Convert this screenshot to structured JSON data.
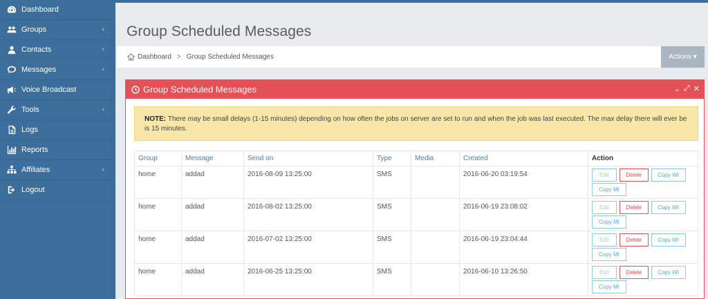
{
  "sidebar": {
    "items": [
      {
        "label": "Dashboard",
        "icon": "dashboard-icon",
        "has_arrow": false
      },
      {
        "label": "Groups",
        "icon": "users-icon",
        "has_arrow": true
      },
      {
        "label": "Contacts",
        "icon": "user-icon",
        "has_arrow": true
      },
      {
        "label": "Messages",
        "icon": "chat-bubble-icon",
        "has_arrow": true
      },
      {
        "label": "Voice Broadcast",
        "icon": "megaphone-icon",
        "has_arrow": false
      },
      {
        "label": "Tools",
        "icon": "wrench-icon",
        "has_arrow": true
      },
      {
        "label": "Logs",
        "icon": "file-icon",
        "has_arrow": false
      },
      {
        "label": "Reports",
        "icon": "bar-chart-icon",
        "has_arrow": false
      },
      {
        "label": "Affiliates",
        "icon": "sitemap-icon",
        "has_arrow": true
      },
      {
        "label": "Logout",
        "icon": "sign-out-icon",
        "has_arrow": false
      }
    ],
    "arrow_glyph": "‹"
  },
  "header": {
    "title": "Group Scheduled Messages",
    "breadcrumb": [
      "Dashboard",
      "Group Scheduled Messages"
    ],
    "breadcrumb_sep": ">",
    "actions_label": "Actions ▾"
  },
  "panel": {
    "title": "Group Scheduled Messages",
    "tools": [
      "⌄",
      "⤢",
      "✕"
    ],
    "note_label": "NOTE:",
    "note_text": " There may be small delays (1-15 minutes) depending on how often the jobs on server are set to run and when the job was last executed. The max delay there will ever be is 15 minutes."
  },
  "table": {
    "headers": [
      "Group",
      "Message",
      "Send on",
      "Type",
      "Media",
      "Created",
      "Action"
    ],
    "rows": [
      {
        "group": "home",
        "message": "addad",
        "send_on": "2016-08-09 13:25:00",
        "type": "SMS",
        "media": "",
        "created": "2016-06-20 03:19:54"
      },
      {
        "group": "home",
        "message": "addad",
        "send_on": "2016-08-02 13:25:00",
        "type": "SMS",
        "media": "",
        "created": "2016-06-19 23:08:02"
      },
      {
        "group": "home",
        "message": "addad",
        "send_on": "2016-07-02 13:25:00",
        "type": "SMS",
        "media": "",
        "created": "2016-06-19 23:04:44"
      },
      {
        "group": "home",
        "message": "addad",
        "send_on": "2016-06-25 13:25:00",
        "type": "SMS",
        "media": "",
        "created": "2016-06-10 13:26:50"
      }
    ],
    "action_labels": {
      "edit": "Edit",
      "delete": "Delete",
      "copy_wl": "Copy WI",
      "copy_ml": "Copy MI"
    }
  },
  "colors": {
    "sidebar": "#3b6e9b",
    "panel_header": "#e35157",
    "note_bg": "#f8e7a9",
    "link": "#4a7fb0"
  }
}
